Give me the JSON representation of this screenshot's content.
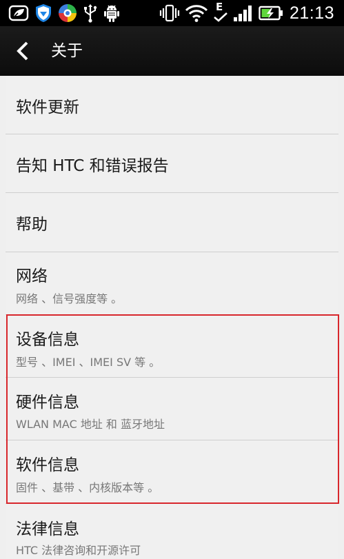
{
  "status_bar": {
    "time": "21:13",
    "network_type": "E",
    "icons": [
      "notification-icon",
      "shield-icon",
      "browser-icon",
      "usb-icon",
      "android-debug-icon",
      "vibrate-icon",
      "wifi-icon",
      "data-e-icon",
      "signal-icon",
      "battery-charging-icon"
    ],
    "colors": {
      "battery": "#5fd63c"
    }
  },
  "header": {
    "title": "关于",
    "back_icon": "chevron-left-icon"
  },
  "list": {
    "items": [
      {
        "title": "软件更新",
        "subtitle": ""
      },
      {
        "title": "告知 HTC 和错误报告",
        "subtitle": ""
      },
      {
        "title": "帮助",
        "subtitle": ""
      },
      {
        "title": "网络",
        "subtitle": "网络 、信号强度等 。"
      },
      {
        "title": "设备信息",
        "subtitle": "型号 、IMEI 、IMEI SV 等 。"
      },
      {
        "title": "硬件信息",
        "subtitle": "WLAN MAC 地址 和 蓝牙地址"
      },
      {
        "title": "软件信息",
        "subtitle": "固件 、基带 、内核版本等 。"
      },
      {
        "title": "法律信息",
        "subtitle": "HTC 法律咨询和开源许可"
      }
    ]
  },
  "highlight": {
    "color": "#d8262b"
  }
}
